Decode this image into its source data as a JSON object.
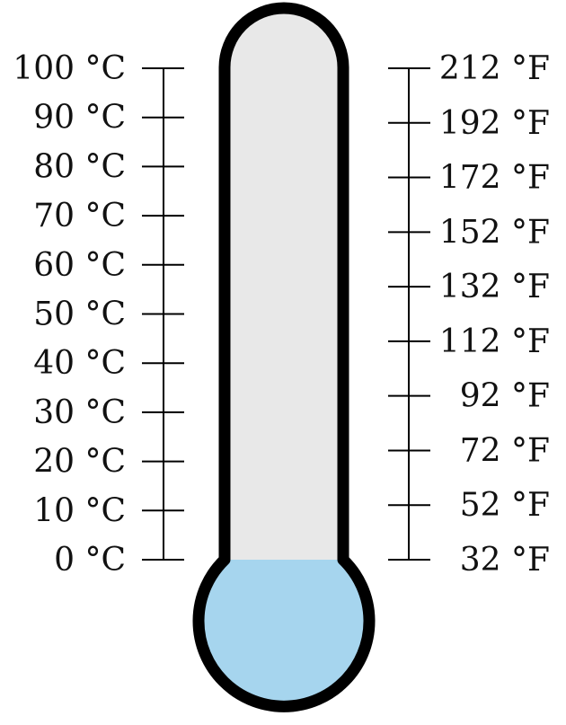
{
  "thermometer": {
    "colors": {
      "outline": "#000000",
      "tube_fill": "#e8e8e8",
      "liquid_fill": "#a6d5ee",
      "scale_line": "#000000"
    },
    "level_celsius": 0
  },
  "celsius_scale": {
    "values": [
      0,
      10,
      20,
      30,
      40,
      50,
      60,
      70,
      80,
      90,
      100
    ],
    "labels": [
      "0 °C",
      "10 °C",
      "20 °C",
      "30 °C",
      "40 °C",
      "50 °C",
      "60 °C",
      "70 °C",
      "80 °C",
      "90 °C",
      "100 °C"
    ]
  },
  "fahrenheit_scale": {
    "values": [
      32,
      52,
      72,
      92,
      112,
      132,
      152,
      172,
      192,
      212
    ],
    "labels": [
      "32 °F",
      "52 °F",
      "72 °F",
      "92 °F",
      "112 °F",
      "132 °F",
      "152 °F",
      "172 °F",
      "192 °F",
      "212 °F"
    ]
  }
}
